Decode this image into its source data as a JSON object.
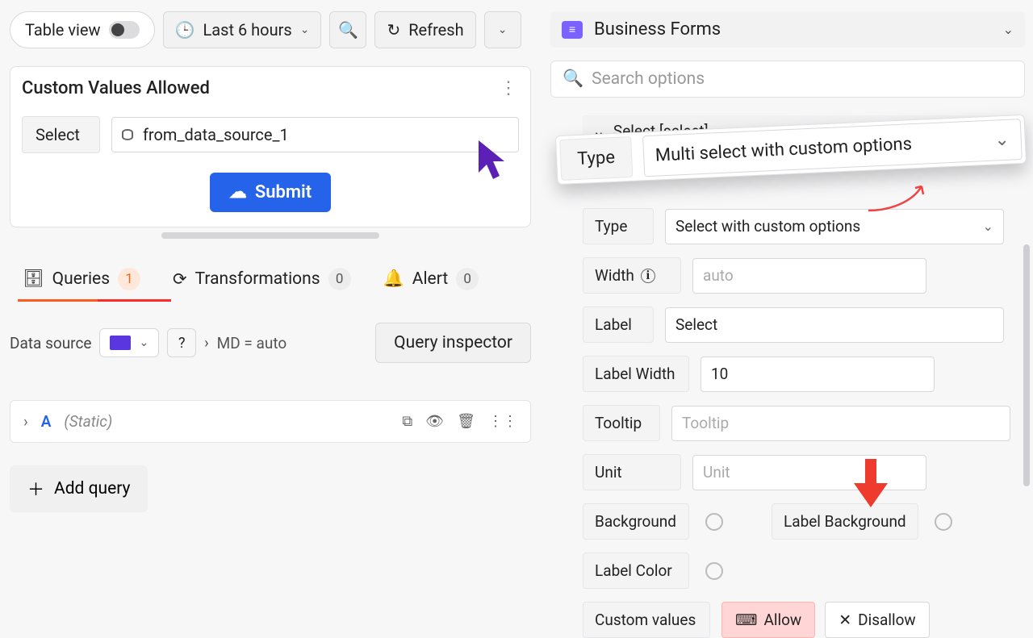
{
  "toolbar": {
    "table_view": "Table view",
    "time_range": "Last 6 hours",
    "refresh": "Refresh"
  },
  "panel": {
    "title": "Custom Values Allowed",
    "select_label": "Select",
    "select_value": "from_data_source_1",
    "submit": "Submit"
  },
  "tabs": {
    "queries": {
      "label": "Queries",
      "count": "1"
    },
    "transforms": {
      "label": "Transformations",
      "count": "0"
    },
    "alert": {
      "label": "Alert",
      "count": "0"
    }
  },
  "query_bar": {
    "data_source_label": "Data source",
    "md_text": "MD = auto",
    "inspector": "Query inspector"
  },
  "query_item": {
    "letter": "A",
    "source": "(Static)"
  },
  "add_query": "Add query",
  "right": {
    "title": "Business Forms",
    "search_placeholder": "Search options",
    "section_title": "Select [select]",
    "float_type_label": "Type",
    "float_type_value": "Multi select with custom options",
    "fields": {
      "type_label": "Type",
      "type_value": "Select with custom options",
      "width_label": "Width",
      "width_value": "auto",
      "label_label": "Label",
      "label_value": "Select",
      "label_width_label": "Label Width",
      "label_width_value": "10",
      "tooltip_label": "Tooltip",
      "tooltip_placeholder": "Tooltip",
      "unit_label": "Unit",
      "unit_placeholder": "Unit",
      "background_label": "Background",
      "label_background_label": "Label Background",
      "label_color_label": "Label Color",
      "custom_values_label": "Custom values",
      "allow": "Allow",
      "disallow": "Disallow"
    }
  }
}
